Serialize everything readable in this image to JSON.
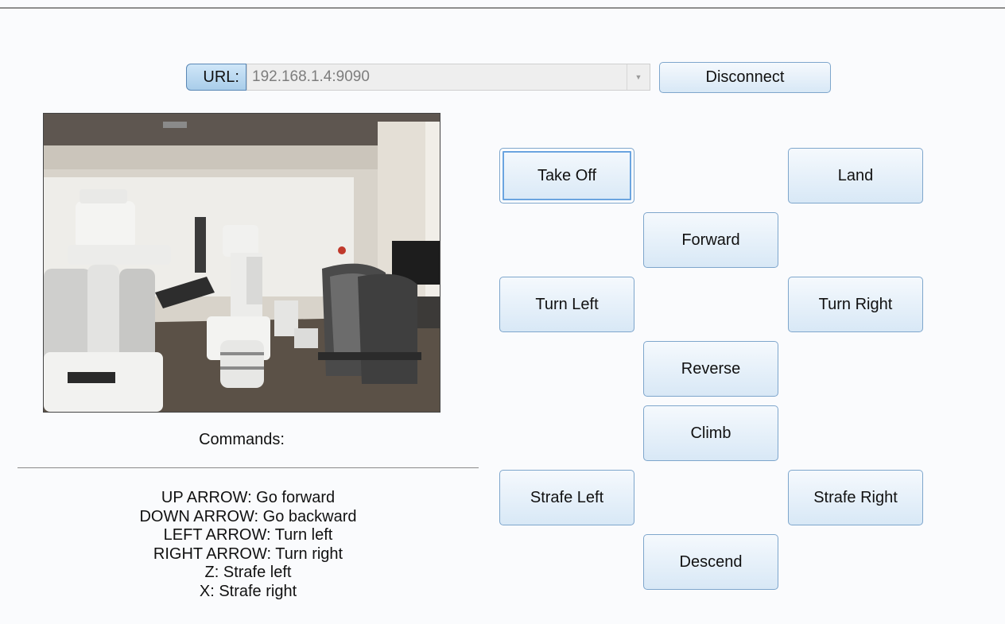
{
  "connection": {
    "url_label": "URL:",
    "url_value": "192.168.1.4:9090",
    "disconnect_label": "Disconnect"
  },
  "camera": {
    "icon": "camera-feed-image"
  },
  "controls": {
    "take_off": "Take Off",
    "land": "Land",
    "forward": "Forward",
    "turn_left": "Turn Left",
    "turn_right": "Turn Right",
    "reverse": "Reverse",
    "climb": "Climb",
    "strafe_left": "Strafe Left",
    "strafe_right": "Strafe Right",
    "descend": "Descend"
  },
  "commands": {
    "title": "Commands:",
    "items": [
      "UP ARROW: Go forward",
      "DOWN ARROW: Go backward",
      "LEFT ARROW: Turn left",
      "RIGHT ARROW: Turn right",
      "Z: Strafe left",
      "X: Strafe right"
    ]
  },
  "colors": {
    "button_border": "#7ea6cc",
    "focus_ring": "#6aa4e0",
    "label_fill": "#a9cdea"
  }
}
